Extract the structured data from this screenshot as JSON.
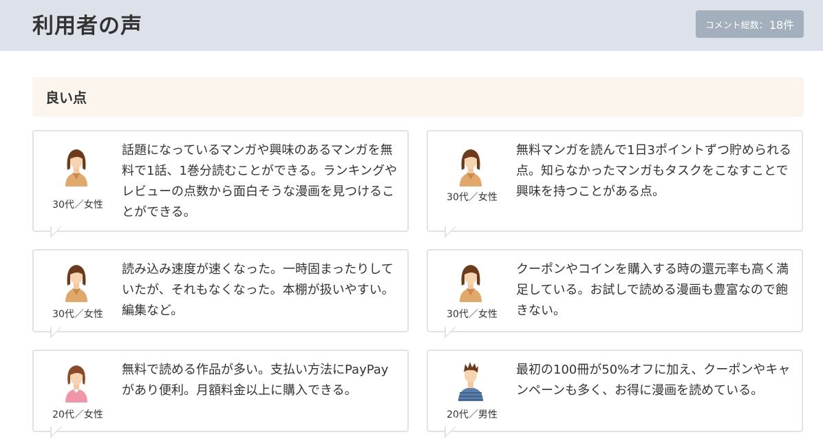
{
  "header": {
    "title": "利用者の声",
    "badge_label": "コメント総数：",
    "badge_count": "18件"
  },
  "section": {
    "title": "良い点"
  },
  "colors": {
    "header_bg": "#dde2ea",
    "badge_bg": "#a3afbd",
    "section_bg": "#fbf5ee",
    "card_border": "#dfe2e6"
  },
  "reviews": [
    {
      "icon": "female-avatar-icon",
      "demographic": "30代／女性",
      "text": "話題になっているマンガや興味のあるマンガを無料で1話、1巻分読むことができる。ランキングやレビューの点数から面白そうな漫画を見つけることができる。"
    },
    {
      "icon": "female-avatar-icon",
      "demographic": "30代／女性",
      "text": "無料マンガを読んで1日3ポイントずつ貯められる点。知らなかったマンガもタスクをこなすことで興味を持つことがある点。"
    },
    {
      "icon": "female-avatar-icon",
      "demographic": "30代／女性",
      "text": "読み込み速度が速くなった。一時固まったりしていたが、それもなくなった。本棚が扱いやすい。編集など。"
    },
    {
      "icon": "female-avatar-icon",
      "demographic": "30代／女性",
      "text": "クーポンやコインを購入する時の還元率も高く満足している。お試しで読める漫画も豊富なので飽きない。"
    },
    {
      "icon": "female-avatar-pink-icon",
      "demographic": "20代／女性",
      "text": "無料で読める作品が多い。支払い方法にPayPayがあり便利。月額料金以上に購入できる。"
    },
    {
      "icon": "male-avatar-icon",
      "demographic": "20代／男性",
      "text": "最初の100冊が50%オフに加え、クーポンやキャンペーンも多く、お得に漫画を読めている。"
    }
  ]
}
